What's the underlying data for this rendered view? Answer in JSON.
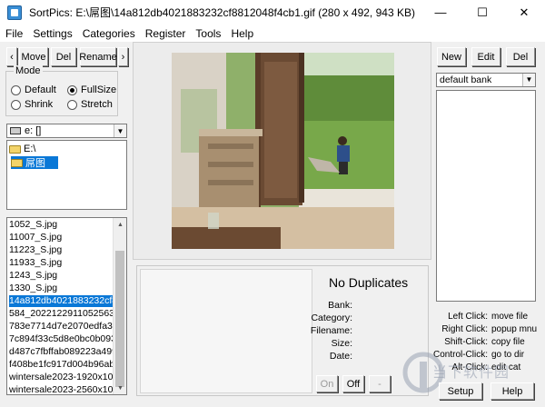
{
  "window": {
    "title": "SortPics: E:\\屌图\\14a812db4021883232cf8812048f4cb1.gif (280 x 492, 943 KB)",
    "minimize": "—",
    "maximize": "☐",
    "close": "✕"
  },
  "menu": [
    "File",
    "Settings",
    "Categories",
    "Register",
    "Tools",
    "Help"
  ],
  "toolbar": {
    "prev": "‹",
    "move": "Move",
    "del": "Del",
    "rename": "Rename",
    "next": "›"
  },
  "mode": {
    "legend": "Mode",
    "options": [
      "Default",
      "FullSize",
      "Shrink",
      "Stretch"
    ],
    "selected": "FullSize"
  },
  "drive": {
    "value": "e: []"
  },
  "tree": [
    "E:\\",
    "屌图"
  ],
  "files": [
    "1052_S.jpg",
    "11007_S.jpg",
    "11223_S.jpg",
    "11933_S.jpg",
    "1243_S.jpg",
    "1330_S.jpg",
    "14a812db4021883232cf88",
    "584_20221229110525633.",
    "783e7714d7e2070edfa3d7",
    "7c894f33c5d8e0bc0b0930",
    "d487c7fbffab089223a499a",
    "f408be1fc917d004b96ab91",
    "wintersale2023-1920x1080.",
    "wintersale2023-2560x1080."
  ],
  "selected_file_index": 6,
  "info": {
    "status": "No Duplicates",
    "labels": [
      "Bank:",
      "Category:",
      "Filename:",
      "Size:",
      "Date:"
    ],
    "on": "On",
    "off": "Off",
    "dash": "-"
  },
  "bank": {
    "new": "New",
    "edit": "Edit",
    "del": "Del",
    "selected": "default bank"
  },
  "help": [
    {
      "key": "Left Click:",
      "value": "move file"
    },
    {
      "key": "Right Click:",
      "value": "popup mnu"
    },
    {
      "key": "Shift-Click:",
      "value": "copy file"
    },
    {
      "key": "Control-Click:",
      "value": "go to dir"
    },
    {
      "key": "Alt-Click:",
      "value": "edit cat"
    }
  ],
  "bottom": {
    "setup": "Setup",
    "help": "Help"
  },
  "watermark": "当下软件园"
}
